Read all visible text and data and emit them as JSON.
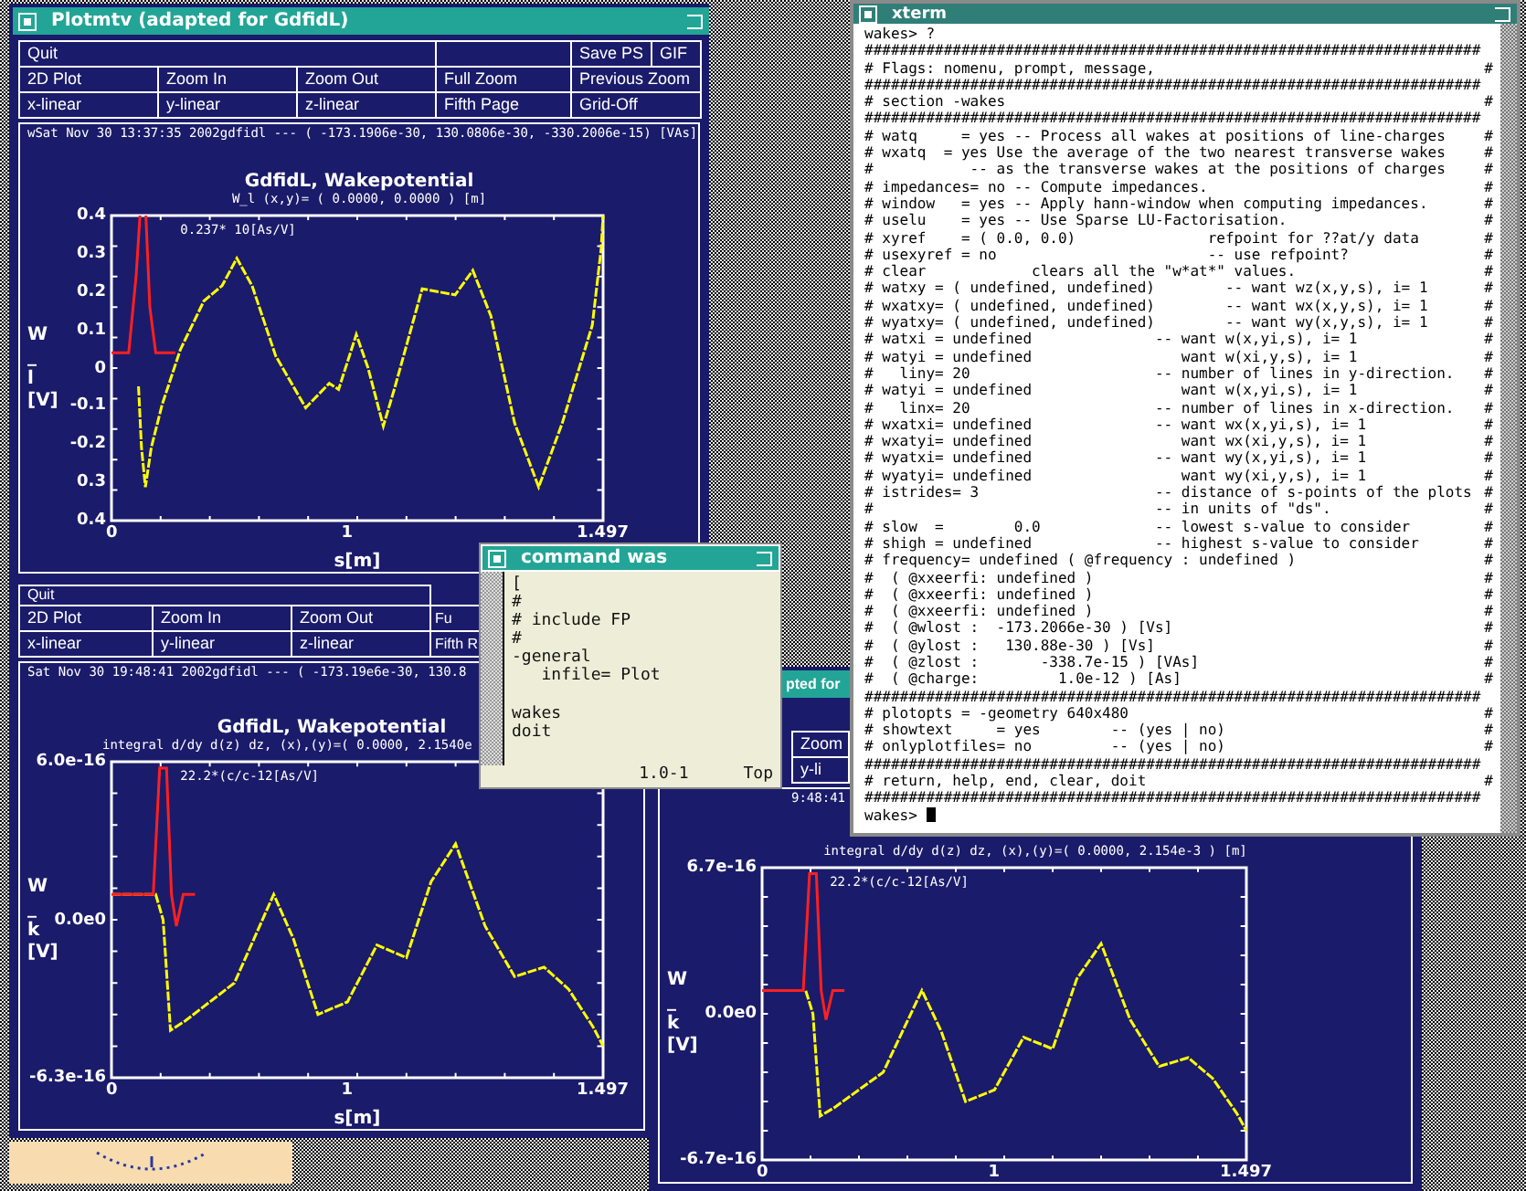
{
  "windows": [
    {
      "kind": "plot",
      "title": "Plotmtv (adapted for GdfidL)",
      "menu": [
        [
          "Quit",
          "Save PS",
          "GIF"
        ],
        [
          "2D Plot",
          "Zoom In",
          "Zoom Out",
          "Full Zoom",
          "Previous Zoom"
        ],
        [
          "x-linear",
          "y-linear",
          "z-linear",
          "Fifth Page",
          "Grid-Off"
        ]
      ],
      "plot": {
        "header": "wSat Nov 30 13:37:35 2002gdfidl --- ( -173.1906e-30, 130.0806e-30, -330.2006e-15) [VAs]",
        "title": "GdfidL, Wakepotential",
        "subtitle": "W_l (x,y)= ( 0.0000, 0.0000 ) [m]",
        "annotation": "0.237* 10[As/V]",
        "ylabel": "W_l[V]",
        "yticks": [
          "0.4",
          "0.3",
          "0.2",
          "0.1",
          "0",
          "-0.1",
          "-0.2",
          "0.3",
          "0.4"
        ],
        "xticks": [
          "0",
          "1",
          "1.497"
        ],
        "xlabel": "s[m]"
      }
    },
    {
      "kind": "plot",
      "menu": [
        [
          "Quit"
        ],
        [
          "2D Plot",
          "Zoom In",
          "Zoom Out",
          "Fu"
        ],
        [
          "x-linear",
          "y-linear",
          "z-linear",
          "Fifth R"
        ]
      ],
      "plot": {
        "header": "Sat Nov 30 19:48:41 2002gdfidl --- ( -173.19e6e-30, 130.8",
        "title": "GdfidL, Wakepotential",
        "subtitle": "integral d/dy d(z) dz, (x),(y)=( 0.0000, 2.1540e",
        "annotation": "22.2*(c/c-12[As/V]",
        "ylabel": "W_k[V]",
        "yticks": [
          "6.0e-16",
          "0.0e0",
          "-6.3e-16"
        ],
        "xticks": [
          "0",
          "1",
          "1.497"
        ],
        "xlabel": "s[m]"
      }
    },
    {
      "kind": "plot",
      "title": "pted for",
      "menu": [
        [
          "Zoom"
        ],
        [
          "y-li"
        ]
      ],
      "plot": {
        "header": "9:48:41",
        "subtitle": "integral d/dy d(z) dz, (x),(y)=( 0.0000, 2.154e-3 ) [m]",
        "annotation": "22.2*(c/c-12[As/V]",
        "ylabel": "W_k[V]",
        "yticks": [
          "6.7e-16",
          "0.0e0",
          "-6.7e-16"
        ],
        "xticks": [
          "0",
          "1",
          "1.497"
        ]
      }
    },
    {
      "kind": "editor",
      "title": "command was",
      "paragraphs": [
        [
          "[",
          "#",
          "# include FP",
          "#",
          "-general",
          "   infile= Plot"
        ],
        [
          "wakes",
          "doit"
        ]
      ],
      "position": "1.0-1",
      "scroll": "Top"
    },
    {
      "kind": "terminal",
      "title": "xterm",
      "lines": [
        {
          "kind": "prompt",
          "text": "wakes> ?",
          "cursor": false
        },
        {
          "kind": "rule",
          "text": "######################################################################"
        },
        {
          "kind": "row",
          "left": "#",
          "text": "Flags: nomenu, prompt, message,",
          "right": "#"
        },
        {
          "kind": "rule",
          "text": "######################################################################"
        },
        {
          "kind": "row",
          "left": "#",
          "text": "section -wakes",
          "right": "#"
        },
        {
          "kind": "rule",
          "text": "######################################################################"
        },
        {
          "kind": "row",
          "left": "#",
          "text": "watq     = yes -- Process all wakes at positions of line-charges",
          "right": "#"
        },
        {
          "kind": "row",
          "left": "#",
          "text": "wxatq  = yes Use the average of the two nearest transverse wakes",
          "right": "#"
        },
        {
          "kind": "row",
          "left": "#",
          "text": "          -- as the transverse wakes at the positions of charges",
          "right": "#"
        },
        {
          "kind": "row",
          "left": "#",
          "text": "impedances= no -- Compute impedances.",
          "right": "#"
        },
        {
          "kind": "row",
          "left": "#",
          "text": "window   = yes -- Apply hann-window when computing impedances.",
          "right": "#"
        },
        {
          "kind": "row",
          "left": "#",
          "text": "uselu    = yes -- Use Sparse LU-Factorisation.",
          "right": "#"
        },
        {
          "kind": "row",
          "left": "#",
          "text": "xyref    = ( 0.0, 0.0)               refpoint for ??at/y data",
          "right": "#"
        },
        {
          "kind": "row",
          "left": "#",
          "text": "usexyref = no                        -- use refpoint?",
          "right": "#"
        },
        {
          "kind": "row",
          "left": "#",
          "text": "clear            clears all the \"w*at*\" values.",
          "right": "#"
        },
        {
          "kind": "row",
          "left": "#",
          "text": "watxy = ( undefined, undefined)        -- want wz(x,y,s), i= 1",
          "right": "#"
        },
        {
          "kind": "row",
          "left": "#",
          "text": "wxatxy= ( undefined, undefined)        -- want wx(x,y,s), i= 1",
          "right": "#"
        },
        {
          "kind": "row",
          "left": "#",
          "text": "wyatxy= ( undefined, undefined)        -- want wy(x,y,s), i= 1",
          "right": "#"
        },
        {
          "kind": "row",
          "left": "#",
          "text": "watxi = undefined              -- want w(x,yi,s), i= 1",
          "right": "#"
        },
        {
          "kind": "row",
          "left": "#",
          "text": "watyi = undefined                 want w(xi,y,s), i= 1",
          "right": "#"
        },
        {
          "kind": "row",
          "left": "#",
          "text": "  liny= 20                     -- number of lines in y-direction.",
          "right": "#"
        },
        {
          "kind": "row",
          "left": "#",
          "text": "watyi = undefined                 want w(x,yi,s), i= 1",
          "right": "#"
        },
        {
          "kind": "row",
          "left": "#",
          "text": "  linx= 20                     -- number of lines in x-direction.",
          "right": "#"
        },
        {
          "kind": "row",
          "left": "#",
          "text": "wxatxi= undefined              -- want wx(x,yi,s), i= 1",
          "right": "#"
        },
        {
          "kind": "row",
          "left": "#",
          "text": "wxatyi= undefined                 want wx(xi,y,s), i= 1",
          "right": "#"
        },
        {
          "kind": "row",
          "left": "#",
          "text": "wyatxi= undefined              -- want wy(x,yi,s), i= 1",
          "right": "#"
        },
        {
          "kind": "row",
          "left": "#",
          "text": "wyatyi= undefined                 want wy(xi,y,s), i= 1",
          "right": "#"
        },
        {
          "kind": "row",
          "left": "#",
          "text": "istrides= 3                    -- distance of s-points of the plots",
          "right": "#"
        },
        {
          "kind": "row",
          "left": "#",
          "text": "                               -- in units of \"ds\".",
          "right": "#"
        },
        {
          "kind": "row",
          "left": "#",
          "text": "slow  =        0.0             -- lowest s-value to consider",
          "right": "#"
        },
        {
          "kind": "row",
          "left": "#",
          "text": "shigh = undefined              -- highest s-value to consider",
          "right": "#"
        },
        {
          "kind": "row",
          "left": "#",
          "text": "frequency= undefined ( @frequency : undefined )",
          "right": "#"
        },
        {
          "kind": "row",
          "left": "#",
          "text": " ( @xxeerfi: undefined )",
          "right": "#"
        },
        {
          "kind": "row",
          "left": "#",
          "text": " ( @xxeerfi: undefined )",
          "right": "#"
        },
        {
          "kind": "row",
          "left": "#",
          "text": " ( @xxeerfi: undefined )",
          "right": "#"
        },
        {
          "kind": "row",
          "left": "#",
          "text": " ( @wlost :  -173.2066e-30 ) [Vs]",
          "right": "#"
        },
        {
          "kind": "row",
          "left": "#",
          "text": " ( @ylost :   130.88e-30 ) [Vs]",
          "right": "#"
        },
        {
          "kind": "row",
          "left": "#",
          "text": " ( @zlost :       -338.7e-15 ) [VAs]",
          "right": "#"
        },
        {
          "kind": "row",
          "left": "#",
          "text": " ( @charge:         1.0e-12 ) [As]",
          "right": "#"
        },
        {
          "kind": "rule",
          "text": "######################################################################"
        },
        {
          "kind": "row",
          "left": "#",
          "text": "plotopts = -geometry 640x480",
          "right": "#"
        },
        {
          "kind": "row",
          "left": "#",
          "text": "showtext     = yes        -- (yes | no)",
          "right": "#"
        },
        {
          "kind": "row",
          "left": "#",
          "text": "onlyplotfiles= no         -- (yes | no)",
          "right": "#"
        },
        {
          "kind": "rule",
          "text": "######################################################################"
        },
        {
          "kind": "row",
          "left": "#",
          "text": "return, help, end, clear, doit",
          "right": "#"
        },
        {
          "kind": "rule",
          "text": "######################################################################"
        },
        {
          "kind": "prompt",
          "text": "wakes> ",
          "cursor": true
        }
      ]
    }
  ]
}
